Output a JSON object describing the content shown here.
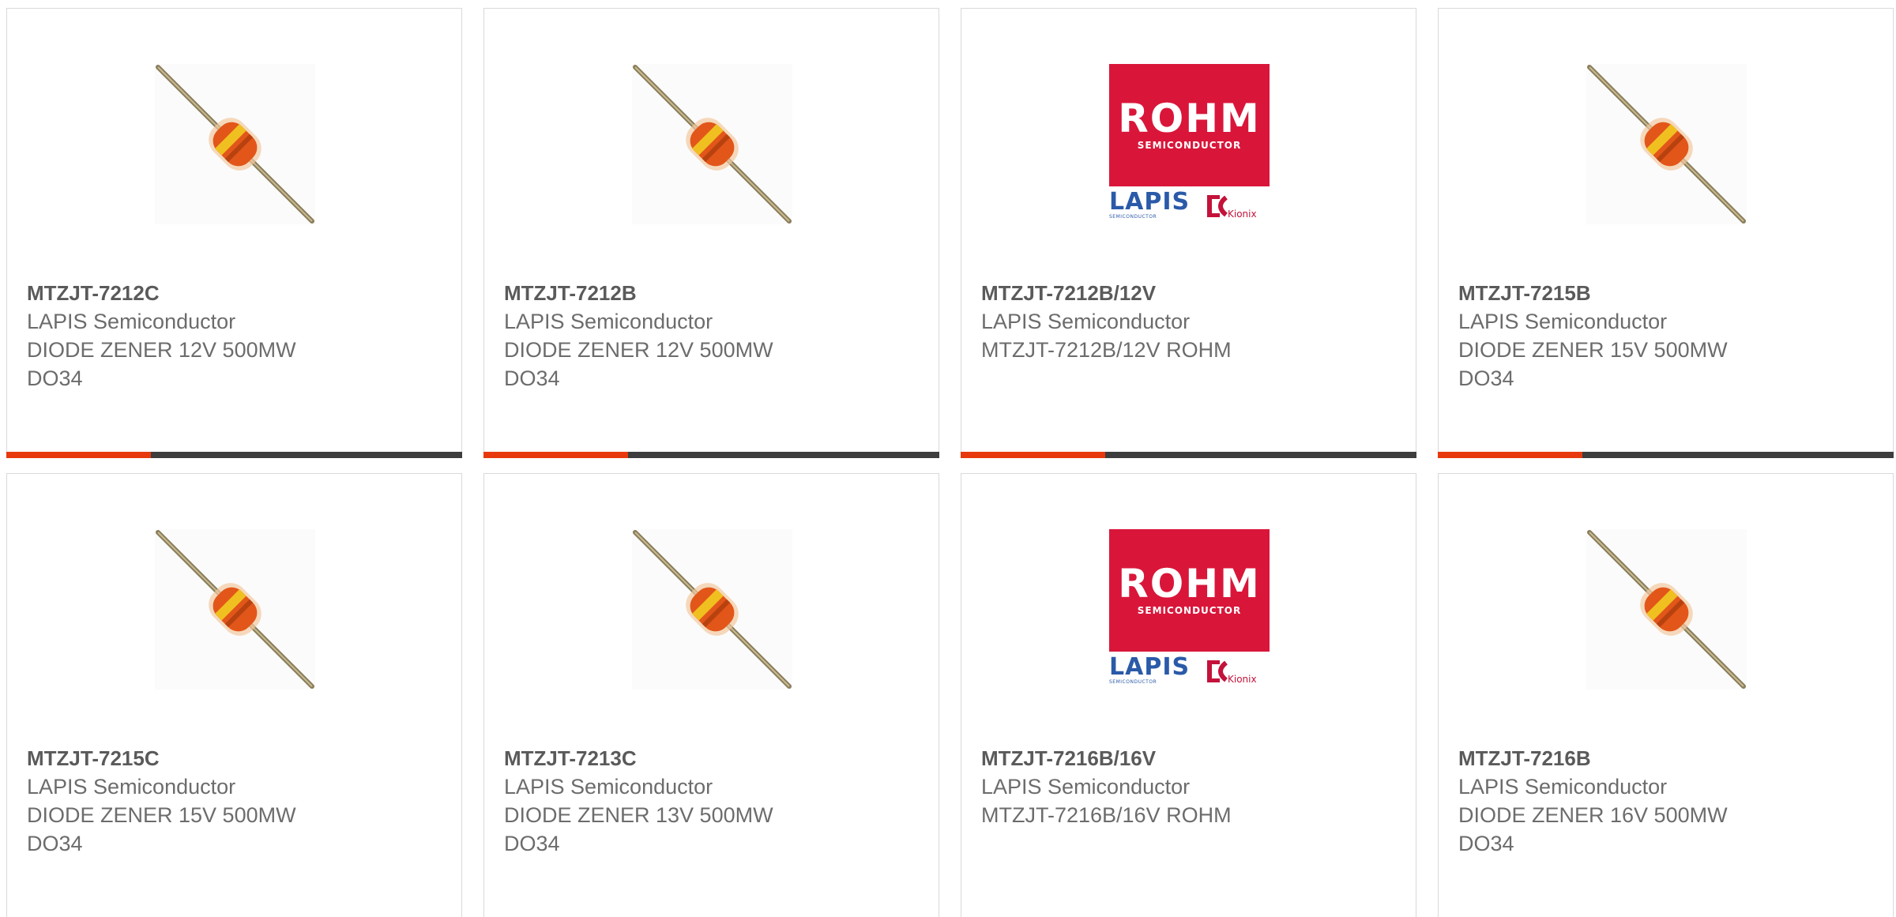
{
  "colors": {
    "accent": "#e8390e",
    "bar": "#3d3d3d",
    "rohm_red": "#d9163a",
    "lapis_blue": "#2a5aa8"
  },
  "products": [
    {
      "part": "MTZJT-7212C",
      "manufacturer": "LAPIS Semiconductor",
      "description": "DIODE ZENER 12V 500MW",
      "package": "DO34",
      "image": "diode-image"
    },
    {
      "part": "MTZJT-7212B",
      "manufacturer": "LAPIS Semiconductor",
      "description": "DIODE ZENER 12V 500MW",
      "package": "DO34",
      "image": "diode-image"
    },
    {
      "part": "MTZJT-7212B/12V",
      "manufacturer": "LAPIS Semiconductor",
      "description": "MTZJT-7212B/12V ROHM",
      "package": "",
      "image": "rohm-logo",
      "logo": {
        "brand": "ROHM",
        "brand_sub": "SEMICONDUCTOR",
        "lapis": "LAPIS",
        "lapis_sub": "SEMICONDUCTOR",
        "kionix": "Kionix"
      }
    },
    {
      "part": "MTZJT-7215B",
      "manufacturer": "LAPIS Semiconductor",
      "description": "DIODE ZENER 15V 500MW",
      "package": "DO34",
      "image": "diode-image"
    },
    {
      "part": "MTZJT-7215C",
      "manufacturer": "LAPIS Semiconductor",
      "description": "DIODE ZENER 15V 500MW",
      "package": "DO34",
      "image": "diode-image"
    },
    {
      "part": "MTZJT-7213C",
      "manufacturer": "LAPIS Semiconductor",
      "description": "DIODE ZENER 13V 500MW",
      "package": "DO34",
      "image": "diode-image"
    },
    {
      "part": "MTZJT-7216B/16V",
      "manufacturer": "LAPIS Semiconductor",
      "description": "MTZJT-7216B/16V ROHM",
      "package": "",
      "image": "rohm-logo",
      "logo": {
        "brand": "ROHM",
        "brand_sub": "SEMICONDUCTOR",
        "lapis": "LAPIS",
        "lapis_sub": "SEMICONDUCTOR",
        "kionix": "Kionix"
      }
    },
    {
      "part": "MTZJT-7216B",
      "manufacturer": "LAPIS Semiconductor",
      "description": "DIODE ZENER 16V 500MW",
      "package": "DO34",
      "image": "diode-image"
    }
  ]
}
